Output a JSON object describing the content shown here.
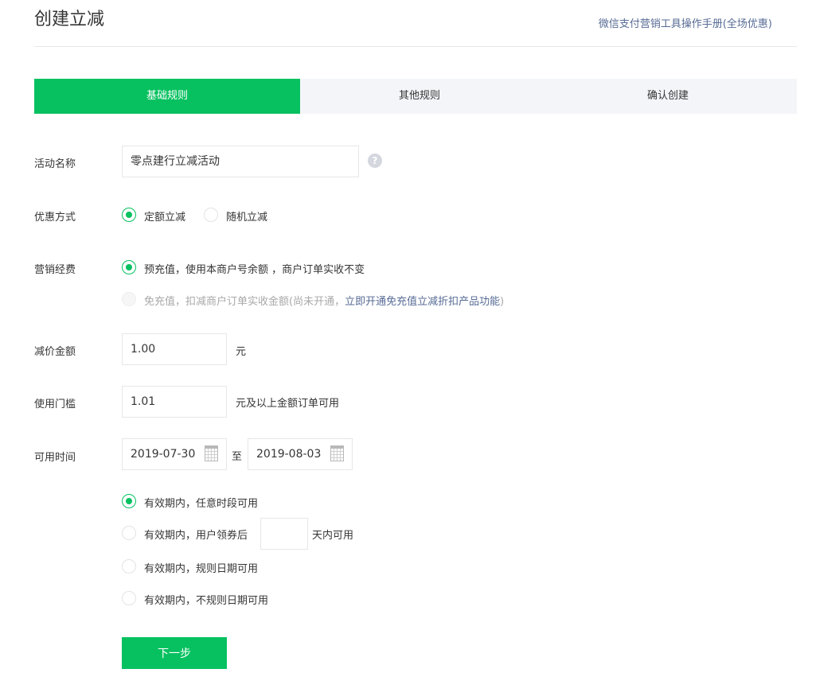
{
  "header": {
    "title": "创建立减",
    "manual_link": "微信支付营销工具操作手册(全场优惠)"
  },
  "steps": [
    {
      "label": "基础规则",
      "active": true
    },
    {
      "label": "其他规则",
      "active": false
    },
    {
      "label": "确认创建",
      "active": false
    }
  ],
  "form": {
    "activity_name": {
      "label": "活动名称",
      "value": "零点建行立减活动",
      "help": "?"
    },
    "discount_mode": {
      "label": "优惠方式",
      "options": [
        {
          "label": "定额立减",
          "checked": true
        },
        {
          "label": "随机立减",
          "checked": false
        }
      ]
    },
    "marketing_fee": {
      "label": "营销经费",
      "options": [
        {
          "label": "预充值，使用本商户号余额 ，商户订单实收不变",
          "checked": true,
          "disabled": false
        },
        {
          "label": "免充值，扣减商户订单实收金额(尚未开通，",
          "link": "立即开通免充值立减折扣产品功能",
          "tail": ")",
          "checked": false,
          "disabled": true
        }
      ]
    },
    "reduce_amount": {
      "label": "减价金额",
      "value": "1.00",
      "unit": "元"
    },
    "threshold": {
      "label": "使用门槛",
      "value": "1.01",
      "unit": "元及以上金额订单可用"
    },
    "available_time": {
      "label": "可用时间",
      "start": "2019-07-30",
      "separator": "至",
      "end": "2019-08-03",
      "options": [
        {
          "label": "有效期内，任意时段可用",
          "checked": true
        },
        {
          "label": "有效期内，用户领券后",
          "suffix": "天内可用",
          "days_value": "",
          "checked": false
        },
        {
          "label": "有效期内，规则日期可用",
          "checked": false
        },
        {
          "label": "有效期内，不规则日期可用",
          "checked": false
        }
      ]
    }
  },
  "footer": {
    "next_label": "下一步"
  },
  "colors": {
    "accent": "#07c160",
    "link": "#576b95",
    "border": "#e7e7eb"
  }
}
